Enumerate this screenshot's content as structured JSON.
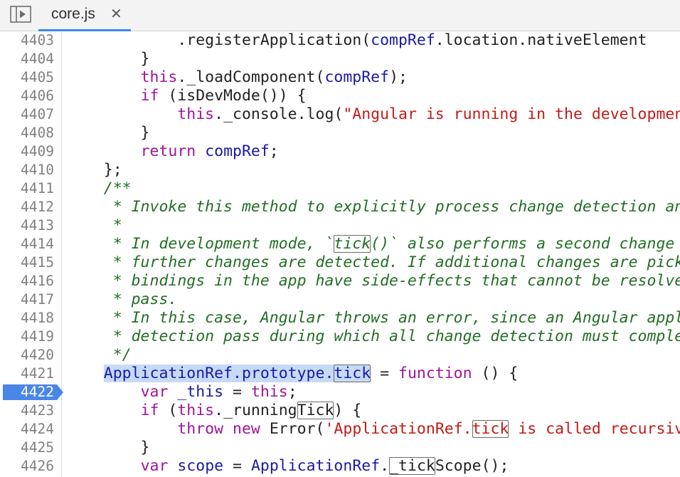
{
  "tabs": [
    {
      "label": "core.js",
      "close": "✕",
      "active": true
    }
  ],
  "icons": {
    "panel_toggle": "panel-toggle-icon",
    "close": "close-icon",
    "breakpoint": "breakpoint-marker"
  },
  "colors": {
    "keyword": "#a0159a",
    "variable": "#1a1aa6",
    "string": "#c41a16",
    "comment": "#236e25",
    "plain": "#222222",
    "line_number": "#808080",
    "breakpoint": "#4a86e8",
    "execution_highlight": "#c6daf6",
    "active_tab_underline": "#4285f4"
  },
  "editor": {
    "breakpoint_line": "4422",
    "lines": [
      {
        "num": "4403",
        "tokens": [
          {
            "t": "            .registerApplication(",
            "c": "plain"
          },
          {
            "t": "compRef",
            "c": "var"
          },
          {
            "t": ".location.nativeElement",
            "c": "plain"
          }
        ]
      },
      {
        "num": "4404",
        "tokens": [
          {
            "t": "        }",
            "c": "plain"
          }
        ]
      },
      {
        "num": "4405",
        "tokens": [
          {
            "t": "        ",
            "c": "plain"
          },
          {
            "t": "this",
            "c": "kw"
          },
          {
            "t": "._loadComponent(",
            "c": "plain"
          },
          {
            "t": "compRef",
            "c": "var"
          },
          {
            "t": ");",
            "c": "plain"
          }
        ]
      },
      {
        "num": "4406",
        "tokens": [
          {
            "t": "        ",
            "c": "plain"
          },
          {
            "t": "if",
            "c": "kw"
          },
          {
            "t": " (isDevMode()) {",
            "c": "plain"
          }
        ]
      },
      {
        "num": "4407",
        "tokens": [
          {
            "t": "            ",
            "c": "plain"
          },
          {
            "t": "this",
            "c": "kw"
          },
          {
            "t": "._console.log(",
            "c": "plain"
          },
          {
            "t": "\"Angular is running in the development mode.",
            "c": "str"
          }
        ]
      },
      {
        "num": "4408",
        "tokens": [
          {
            "t": "        }",
            "c": "plain"
          }
        ]
      },
      {
        "num": "4409",
        "tokens": [
          {
            "t": "        ",
            "c": "plain"
          },
          {
            "t": "return",
            "c": "kw"
          },
          {
            "t": " ",
            "c": "plain"
          },
          {
            "t": "compRef",
            "c": "var"
          },
          {
            "t": ";",
            "c": "plain"
          }
        ]
      },
      {
        "num": "4410",
        "tokens": [
          {
            "t": "    };",
            "c": "plain"
          }
        ]
      },
      {
        "num": "4411",
        "tokens": [
          {
            "t": "    /**",
            "c": "comment"
          }
        ]
      },
      {
        "num": "4412",
        "tokens": [
          {
            "t": "     * Invoke this method to explicitly process change detection and",
            "c": "comment"
          }
        ]
      },
      {
        "num": "4413",
        "tokens": [
          {
            "t": "     *",
            "c": "comment"
          }
        ]
      },
      {
        "num": "4414",
        "tokens": [
          {
            "t": "     * In development mode, `",
            "c": "comment"
          },
          {
            "t": "tick",
            "c": "comment",
            "search": true
          },
          {
            "t": "()` also performs a second change detection",
            "c": "comment"
          }
        ]
      },
      {
        "num": "4415",
        "tokens": [
          {
            "t": "     * further changes are detected. If additional changes are picked",
            "c": "comment"
          }
        ]
      },
      {
        "num": "4416",
        "tokens": [
          {
            "t": "     * bindings in the app have side-effects that cannot be resolved",
            "c": "comment"
          }
        ]
      },
      {
        "num": "4417",
        "tokens": [
          {
            "t": "     * pass.",
            "c": "comment"
          }
        ]
      },
      {
        "num": "4418",
        "tokens": [
          {
            "t": "     * In this case, Angular throws an error, since an Angular application",
            "c": "comment"
          }
        ]
      },
      {
        "num": "4419",
        "tokens": [
          {
            "t": "     * detection pass during which all change detection must complete.",
            "c": "comment"
          }
        ]
      },
      {
        "num": "4420",
        "tokens": [
          {
            "t": "     */",
            "c": "comment"
          }
        ]
      },
      {
        "num": "4421",
        "tokens": [
          {
            "t": "    ",
            "c": "plain"
          },
          {
            "t": "ApplicationRef.prototype.",
            "c": "var",
            "exec": true
          },
          {
            "t": "tick",
            "c": "var",
            "exec": true,
            "search": true
          },
          {
            "t": " = ",
            "c": "plain"
          },
          {
            "t": "function",
            "c": "kw"
          },
          {
            "t": " () {",
            "c": "plain"
          }
        ]
      },
      {
        "num": "4422",
        "breakpoint": true,
        "tokens": [
          {
            "t": "        ",
            "c": "plain"
          },
          {
            "t": "var",
            "c": "kw"
          },
          {
            "t": " ",
            "c": "plain"
          },
          {
            "t": "_this",
            "c": "var"
          },
          {
            "t": " = ",
            "c": "plain"
          },
          {
            "t": "this",
            "c": "kw"
          },
          {
            "t": ";",
            "c": "plain"
          }
        ]
      },
      {
        "num": "4423",
        "tokens": [
          {
            "t": "        ",
            "c": "plain"
          },
          {
            "t": "if",
            "c": "kw"
          },
          {
            "t": " (",
            "c": "plain"
          },
          {
            "t": "this",
            "c": "kw"
          },
          {
            "t": "._running",
            "c": "plain"
          },
          {
            "t": "Tick",
            "c": "plain",
            "search": true
          },
          {
            "t": ") {",
            "c": "plain"
          }
        ]
      },
      {
        "num": "4424",
        "tokens": [
          {
            "t": "            ",
            "c": "plain"
          },
          {
            "t": "throw",
            "c": "kw"
          },
          {
            "t": " ",
            "c": "plain"
          },
          {
            "t": "new",
            "c": "kw"
          },
          {
            "t": " Error(",
            "c": "plain"
          },
          {
            "t": "'ApplicationRef.",
            "c": "str"
          },
          {
            "t": "tick",
            "c": "str",
            "search": true
          },
          {
            "t": " is called recursively'",
            "c": "str"
          }
        ]
      },
      {
        "num": "4425",
        "tokens": [
          {
            "t": "        }",
            "c": "plain"
          }
        ]
      },
      {
        "num": "4426",
        "tokens": [
          {
            "t": "        ",
            "c": "plain"
          },
          {
            "t": "var",
            "c": "kw"
          },
          {
            "t": " ",
            "c": "plain"
          },
          {
            "t": "scope",
            "c": "var"
          },
          {
            "t": " = ",
            "c": "plain"
          },
          {
            "t": "ApplicationRef",
            "c": "var"
          },
          {
            "t": ".",
            "c": "plain"
          },
          {
            "t": "_tick",
            "c": "plain",
            "search": true
          },
          {
            "t": "Scope();",
            "c": "plain"
          }
        ]
      }
    ]
  }
}
